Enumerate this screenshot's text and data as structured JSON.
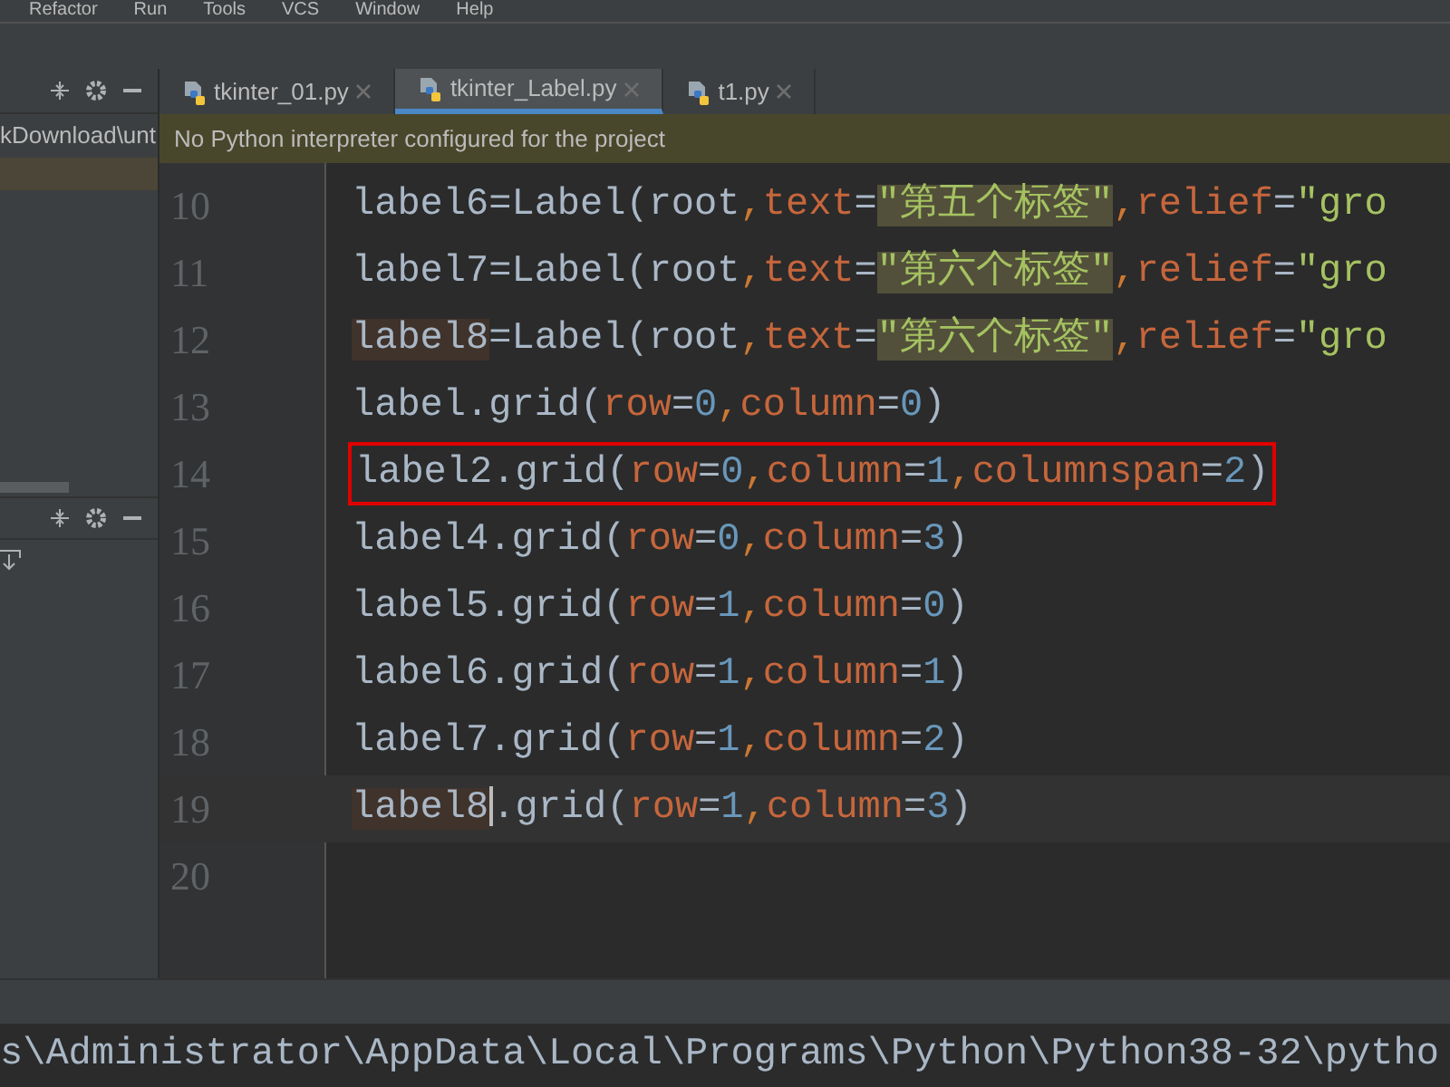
{
  "menu": [
    "Refactor",
    "Run",
    "Tools",
    "VCS",
    "Window",
    "Help"
  ],
  "project_panel": {
    "path": "kDownload\\unt"
  },
  "tabs": [
    {
      "label": "tkinter_01.py",
      "selected": false
    },
    {
      "label": "tkinter_Label.py",
      "selected": true
    },
    {
      "label": "t1.py",
      "selected": false
    }
  ],
  "banner": "No Python interpreter configured for the project",
  "lines": [
    {
      "number": "10",
      "current": false,
      "boxed": false,
      "tokens": [
        {
          "kind": "plain",
          "text": "label6=Label(root"
        },
        {
          "kind": "punct",
          "text": ","
        },
        {
          "kind": "param",
          "text": "text"
        },
        {
          "kind": "plain",
          "text": "="
        },
        {
          "kind": "string",
          "text": "\"第五个标签\""
        },
        {
          "kind": "punct",
          "text": ","
        },
        {
          "kind": "param",
          "text": "relief"
        },
        {
          "kind": "plain",
          "text": "="
        },
        {
          "kind": "string_plain",
          "text": "\"gro"
        }
      ]
    },
    {
      "number": "11",
      "current": false,
      "boxed": false,
      "tokens": [
        {
          "kind": "plain",
          "text": "label7=Label(root"
        },
        {
          "kind": "punct",
          "text": ","
        },
        {
          "kind": "param",
          "text": "text"
        },
        {
          "kind": "plain",
          "text": "="
        },
        {
          "kind": "string",
          "text": "\"第六个标签\""
        },
        {
          "kind": "punct",
          "text": ","
        },
        {
          "kind": "param",
          "text": "relief"
        },
        {
          "kind": "plain",
          "text": "="
        },
        {
          "kind": "string_plain",
          "text": "\"gro"
        }
      ]
    },
    {
      "number": "12",
      "current": false,
      "boxed": false,
      "tokens": [
        {
          "kind": "usage",
          "text": "label8"
        },
        {
          "kind": "plain",
          "text": "=Label(root"
        },
        {
          "kind": "punct",
          "text": ","
        },
        {
          "kind": "param",
          "text": "text"
        },
        {
          "kind": "plain",
          "text": "="
        },
        {
          "kind": "string",
          "text": "\"第六个标签\""
        },
        {
          "kind": "punct",
          "text": ","
        },
        {
          "kind": "param",
          "text": "relief"
        },
        {
          "kind": "plain",
          "text": "="
        },
        {
          "kind": "string_plain",
          "text": "\"gro"
        }
      ]
    },
    {
      "number": "13",
      "current": false,
      "boxed": false,
      "tokens": [
        {
          "kind": "plain",
          "text": "label.grid("
        },
        {
          "kind": "param",
          "text": "row"
        },
        {
          "kind": "plain",
          "text": "="
        },
        {
          "kind": "num",
          "text": "0"
        },
        {
          "kind": "punct",
          "text": ","
        },
        {
          "kind": "param",
          "text": "column"
        },
        {
          "kind": "plain",
          "text": "="
        },
        {
          "kind": "num",
          "text": "0"
        },
        {
          "kind": "plain",
          "text": ")"
        }
      ]
    },
    {
      "number": "14",
      "current": false,
      "boxed": true,
      "tokens": [
        {
          "kind": "plain",
          "text": "label2.grid("
        },
        {
          "kind": "param",
          "text": "row"
        },
        {
          "kind": "plain",
          "text": "="
        },
        {
          "kind": "num",
          "text": "0"
        },
        {
          "kind": "punct",
          "text": ","
        },
        {
          "kind": "param",
          "text": "column"
        },
        {
          "kind": "plain",
          "text": "="
        },
        {
          "kind": "num",
          "text": "1"
        },
        {
          "kind": "punct",
          "text": ","
        },
        {
          "kind": "param",
          "text": "columnspan"
        },
        {
          "kind": "plain",
          "text": "="
        },
        {
          "kind": "num",
          "text": "2"
        },
        {
          "kind": "plain",
          "text": ")"
        }
      ]
    },
    {
      "number": "15",
      "current": false,
      "boxed": false,
      "tokens": [
        {
          "kind": "plain",
          "text": "label4.grid("
        },
        {
          "kind": "param",
          "text": "row"
        },
        {
          "kind": "plain",
          "text": "="
        },
        {
          "kind": "num",
          "text": "0"
        },
        {
          "kind": "punct",
          "text": ","
        },
        {
          "kind": "param",
          "text": "column"
        },
        {
          "kind": "plain",
          "text": "="
        },
        {
          "kind": "num",
          "text": "3"
        },
        {
          "kind": "plain",
          "text": ")"
        }
      ]
    },
    {
      "number": "16",
      "current": false,
      "boxed": false,
      "tokens": [
        {
          "kind": "plain",
          "text": "label5.grid("
        },
        {
          "kind": "param",
          "text": "row"
        },
        {
          "kind": "plain",
          "text": "="
        },
        {
          "kind": "num",
          "text": "1"
        },
        {
          "kind": "punct",
          "text": ","
        },
        {
          "kind": "param",
          "text": "column"
        },
        {
          "kind": "plain",
          "text": "="
        },
        {
          "kind": "num",
          "text": "0"
        },
        {
          "kind": "plain",
          "text": ")"
        }
      ]
    },
    {
      "number": "17",
      "current": false,
      "boxed": false,
      "tokens": [
        {
          "kind": "plain",
          "text": "label6.grid("
        },
        {
          "kind": "param",
          "text": "row"
        },
        {
          "kind": "plain",
          "text": "="
        },
        {
          "kind": "num",
          "text": "1"
        },
        {
          "kind": "punct",
          "text": ","
        },
        {
          "kind": "param",
          "text": "column"
        },
        {
          "kind": "plain",
          "text": "="
        },
        {
          "kind": "num",
          "text": "1"
        },
        {
          "kind": "plain",
          "text": ")"
        }
      ]
    },
    {
      "number": "18",
      "current": false,
      "boxed": false,
      "tokens": [
        {
          "kind": "plain",
          "text": "label7.grid("
        },
        {
          "kind": "param",
          "text": "row"
        },
        {
          "kind": "plain",
          "text": "="
        },
        {
          "kind": "num",
          "text": "1"
        },
        {
          "kind": "punct",
          "text": ","
        },
        {
          "kind": "param",
          "text": "column"
        },
        {
          "kind": "plain",
          "text": "="
        },
        {
          "kind": "num",
          "text": "2"
        },
        {
          "kind": "plain",
          "text": ")"
        }
      ]
    },
    {
      "number": "19",
      "current": true,
      "boxed": false,
      "tokens": [
        {
          "kind": "usage",
          "text": "label8"
        },
        {
          "kind": "plain",
          "text": ".grid("
        },
        {
          "kind": "param",
          "text": "row"
        },
        {
          "kind": "plain",
          "text": "="
        },
        {
          "kind": "num",
          "text": "1"
        },
        {
          "kind": "punct",
          "text": ","
        },
        {
          "kind": "param",
          "text": "column"
        },
        {
          "kind": "plain",
          "text": "="
        },
        {
          "kind": "num",
          "text": "3"
        },
        {
          "kind": "plain",
          "text": ")"
        }
      ]
    },
    {
      "number": "20",
      "current": false,
      "boxed": false
    }
  ],
  "terminal": "s\\Administrator\\AppData\\Local\\Programs\\Python\\Python38-32\\pytho"
}
